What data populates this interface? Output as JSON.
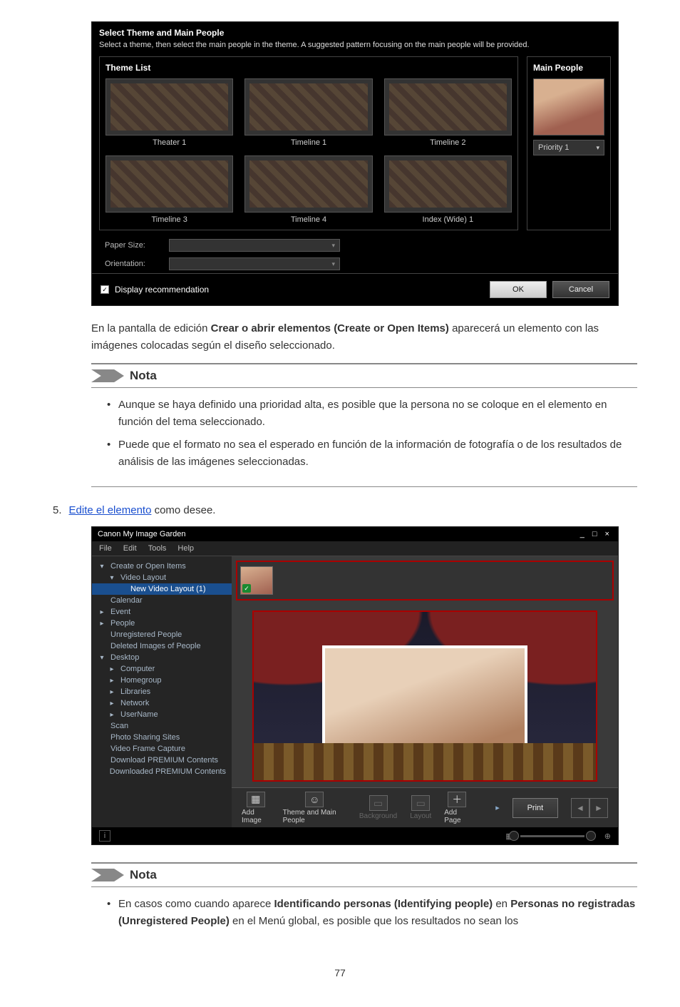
{
  "dialog1": {
    "title": "Select Theme and Main People",
    "subtitle": "Select a theme, then select the main people in the theme. A suggested pattern focusing on the main people will be provided.",
    "theme_list_label": "Theme List",
    "themes": [
      "Theater 1",
      "Timeline 1",
      "Timeline 2",
      "Timeline 3",
      "Timeline 4",
      "Index (Wide) 1"
    ],
    "main_people_label": "Main People",
    "priority_value": "Priority 1",
    "paper_size_label": "Paper Size:",
    "orientation_label": "Orientation:",
    "display_rec_label": "Display recommendation",
    "display_rec_checked": true,
    "ok": "OK",
    "cancel": "Cancel"
  },
  "paragraph1": {
    "pre": "En la pantalla de edición ",
    "bold": "Crear o abrir elementos (Create or Open Items)",
    "post": " aparecerá un elemento con las imágenes colocadas según el diseño seleccionado."
  },
  "note1": {
    "title": "Nota",
    "items": [
      "Aunque se haya definido una prioridad alta, es posible que la persona no se coloque en el elemento en función del tema seleccionado.",
      "Puede que el formato no sea el esperado en función de la información de fotografía o de los resultados de análisis de las imágenes seleccionadas."
    ]
  },
  "step5": {
    "num": "5.",
    "link": "Edite el elemento",
    "after": " como desee."
  },
  "window2": {
    "title": "Canon My Image Garden",
    "window_controls": "_ □ ×",
    "menu": [
      "File",
      "Edit",
      "Tools",
      "Help"
    ],
    "sidebar": [
      {
        "t": "Create or Open Items",
        "ic": "▾",
        "ind": 0
      },
      {
        "t": "Video Layout",
        "ic": "▾",
        "ind": 1
      },
      {
        "t": "New Video Layout (1)",
        "ic": "",
        "ind": 2,
        "sel": true
      },
      {
        "t": "Calendar",
        "ic": "",
        "ind": 0
      },
      {
        "t": "Event",
        "ic": "▸",
        "ind": 0
      },
      {
        "t": "People",
        "ic": "▸",
        "ind": 0
      },
      {
        "t": "Unregistered People",
        "ic": "",
        "ind": 0
      },
      {
        "t": "Deleted Images of People",
        "ic": "",
        "ind": 0
      },
      {
        "t": "Desktop",
        "ic": "▾",
        "ind": 0
      },
      {
        "t": "Computer",
        "ic": "▸",
        "ind": 1
      },
      {
        "t": "Homegroup",
        "ic": "▸",
        "ind": 1
      },
      {
        "t": "Libraries",
        "ic": "▸",
        "ind": 1
      },
      {
        "t": "Network",
        "ic": "▸",
        "ind": 1
      },
      {
        "t": "UserName",
        "ic": "▸",
        "ind": 1
      },
      {
        "t": "Scan",
        "ic": "",
        "ind": 0
      },
      {
        "t": "Photo Sharing Sites",
        "ic": "",
        "ind": 0
      },
      {
        "t": "Video Frame Capture",
        "ic": "",
        "ind": 0
      },
      {
        "t": "Download PREMIUM Contents",
        "ic": "",
        "ind": 0
      },
      {
        "t": "Downloaded PREMIUM Contents",
        "ic": "",
        "ind": 0
      }
    ],
    "toolbar": {
      "add_image": "Add Image",
      "theme_main": "Theme and Main People",
      "background": "Background",
      "layout": "Layout",
      "add_page": "Add Page",
      "print": "Print"
    },
    "status_info": "i"
  },
  "note2": {
    "title": "Nota",
    "line1_pre": "En casos como cuando aparece ",
    "line1_b1": "Identificando personas (Identifying people)",
    "line1_mid": " en ",
    "line1_b2": "Personas no registradas (Unregistered People)",
    "line1_post": " en el Menú global, es posible que los resultados no sean los"
  },
  "page_number": "77"
}
